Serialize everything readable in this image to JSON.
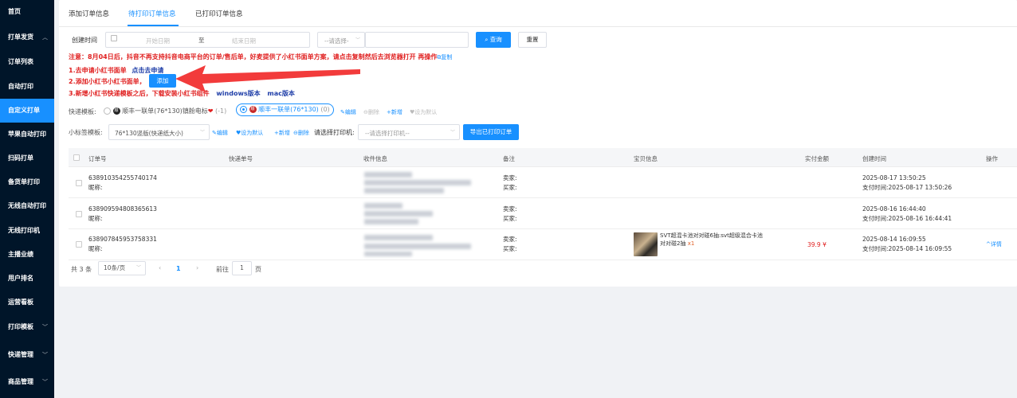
{
  "sidebar": {
    "items": [
      {
        "label": "首页",
        "arrow": ""
      },
      {
        "label": "打单发货",
        "arrow": "^"
      },
      {
        "label": "订单列表",
        "arrow": ""
      },
      {
        "label": "自动打印",
        "arrow": ""
      },
      {
        "label": "自定义打单",
        "arrow": ""
      },
      {
        "label": "苹果自动打印",
        "arrow": ""
      },
      {
        "label": "扫码打单",
        "arrow": ""
      },
      {
        "label": "备货单打印",
        "arrow": ""
      },
      {
        "label": "无线自动打印",
        "arrow": ""
      },
      {
        "label": "无线打印机",
        "arrow": ""
      },
      {
        "label": "主播业绩",
        "arrow": ""
      },
      {
        "label": "用户排名",
        "arrow": ""
      },
      {
        "label": "运营看板",
        "arrow": ""
      },
      {
        "label": "打印模板",
        "arrow": "v"
      },
      {
        "label": "快递管理",
        "arrow": "v"
      },
      {
        "label": "商品管理",
        "arrow": "v"
      }
    ],
    "active_index": 4
  },
  "tabs": [
    "添加订单信息",
    "待打印订单信息",
    "已打印订单信息"
  ],
  "filter": {
    "created_label": "创建时间",
    "start_placeholder": "开始日期",
    "to_label": "至",
    "end_placeholder": "结束日期",
    "select_placeholder": "--请选择-",
    "query_label": "查询",
    "reset_label": "重置"
  },
  "notice": {
    "text": "注意：8月04日后，抖音不再支持抖音电商平台的订单/售后单，好麦提供了小红书面单方案，请点击复制然后去浏览器打开 再操作",
    "copy_label": "复制",
    "step1": "1.去申请小红书面单",
    "step1_link": "点击去申请",
    "step2": "2.添加小红书小红书面单，",
    "add_label": "添加",
    "step3": "3.新增小红书快递模板之后，下载安装小红书组件",
    "windows_label": "windows版本",
    "mac_label": "mac版本"
  },
  "express_template": {
    "label": "快递模板:",
    "option1": "顺丰一联单(76*130)镇舱电标",
    "option1_count": "(-1)",
    "option2": "顺丰一联单(76*130)",
    "option2_count": "(0)",
    "edit": "编辑",
    "delete": "删除",
    "add": "+新增",
    "set_default": "设为默认"
  },
  "tag_template": {
    "label": "小标签模板:",
    "value": "76*130竖版(快递纸大小)",
    "edit": "编辑",
    "set_default": "设为默认",
    "add": "+新增",
    "delete": "删除",
    "printer_label": "请选择打印机:",
    "printer_placeholder": "--请选择打印机--",
    "export_label": "导出已打印订单"
  },
  "table": {
    "headers": [
      "订单号",
      "快递单号",
      "收件信息",
      "备注",
      "宝贝信息",
      "实付金额",
      "创建时间",
      "操作"
    ],
    "rows": [
      {
        "order_no": "638910354255740174",
        "nickname": "昵称:",
        "seller": "卖家:",
        "buyer": "买家:",
        "product": "",
        "qty": "",
        "amount": "",
        "created": "2025-08-17 13:50:25",
        "paid": "支付时间:2025-08-17 13:50:26",
        "action": ""
      },
      {
        "order_no": "638909594808365613",
        "nickname": "昵称:",
        "seller": "卖家:",
        "buyer": "买家:",
        "product": "",
        "qty": "",
        "amount": "",
        "created": "2025-08-16 16:44:40",
        "paid": "支付时间:2025-08-16 16:44:41",
        "action": ""
      },
      {
        "order_no": "638907845953758331",
        "nickname": "昵称:",
        "seller": "卖家:",
        "buyer": "买家:",
        "product": "SVT超混卡池对对碰6抽:svt超级混合卡池对对碰2抽",
        "qty": "x1",
        "amount": "39.9 ¥",
        "created": "2025-08-14 16:09:55",
        "paid": "支付时间:2025-08-14 16:09:55",
        "action": "详情"
      }
    ]
  },
  "pager": {
    "total": "共 3 条",
    "page_size": "10条/页",
    "current": "1",
    "goto_label": "前往",
    "goto_value": "1",
    "page_unit": "页"
  }
}
